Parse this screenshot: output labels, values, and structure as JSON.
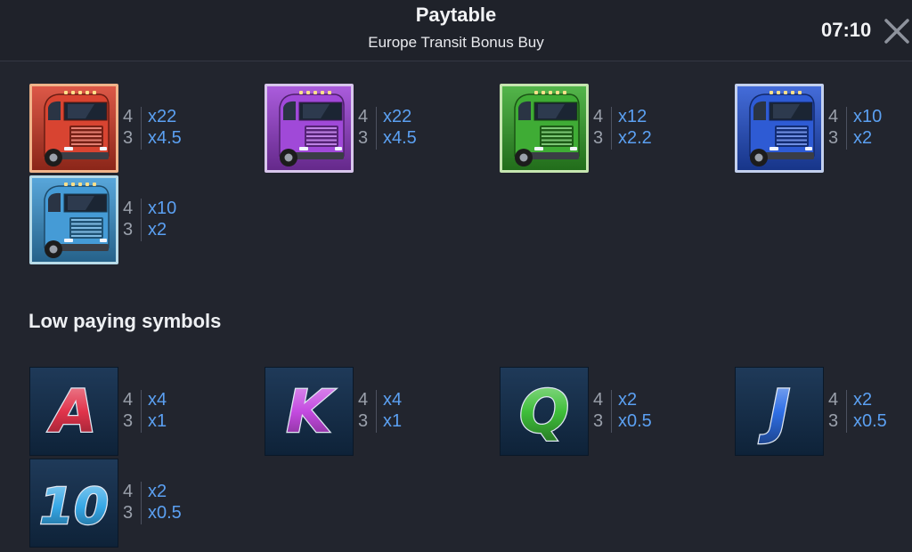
{
  "header": {
    "title": "Paytable",
    "subtitle": "Europe Transit Bonus Buy",
    "clock": "07:10"
  },
  "high_symbols": [
    {
      "name": "red-truck",
      "color": "#d63a26",
      "frame": "#f0b48a",
      "pays": [
        {
          "count": "4",
          "multiplier": "x22"
        },
        {
          "count": "3",
          "multiplier": "x4.5"
        }
      ]
    },
    {
      "name": "purple-truck",
      "color": "#9b3fd6",
      "frame": "#d8c6ec",
      "pays": [
        {
          "count": "4",
          "multiplier": "x22"
        },
        {
          "count": "3",
          "multiplier": "x4.5"
        }
      ]
    },
    {
      "name": "green-truck",
      "color": "#35a82a",
      "frame": "#c6e6b0",
      "pays": [
        {
          "count": "4",
          "multiplier": "x12"
        },
        {
          "count": "3",
          "multiplier": "x2.2"
        }
      ]
    },
    {
      "name": "blue-truck",
      "color": "#2352d2",
      "frame": "#c3d0ee",
      "pays": [
        {
          "count": "4",
          "multiplier": "x10"
        },
        {
          "count": "3",
          "multiplier": "x2"
        }
      ]
    },
    {
      "name": "cyan-truck",
      "color": "#3b96d4",
      "frame": "#b8dbe8",
      "pays": [
        {
          "count": "4",
          "multiplier": "x10"
        },
        {
          "count": "3",
          "multiplier": "x2"
        }
      ]
    }
  ],
  "low_section_title": "Low paying symbols",
  "low_symbols": [
    {
      "name": "A",
      "color": "#e0334b",
      "pays": [
        {
          "count": "4",
          "multiplier": "x4"
        },
        {
          "count": "3",
          "multiplier": "x1"
        }
      ]
    },
    {
      "name": "K",
      "color": "#c44ae0",
      "pays": [
        {
          "count": "4",
          "multiplier": "x4"
        },
        {
          "count": "3",
          "multiplier": "x1"
        }
      ]
    },
    {
      "name": "Q",
      "color": "#3fbf3a",
      "pays": [
        {
          "count": "4",
          "multiplier": "x2"
        },
        {
          "count": "3",
          "multiplier": "x0.5"
        }
      ]
    },
    {
      "name": "J",
      "color": "#2f6fe6",
      "pays": [
        {
          "count": "4",
          "multiplier": "x2"
        },
        {
          "count": "3",
          "multiplier": "x0.5"
        }
      ]
    },
    {
      "name": "10",
      "color": "#35a7e6",
      "pays": [
        {
          "count": "4",
          "multiplier": "x2"
        },
        {
          "count": "3",
          "multiplier": "x0.5"
        }
      ]
    }
  ]
}
